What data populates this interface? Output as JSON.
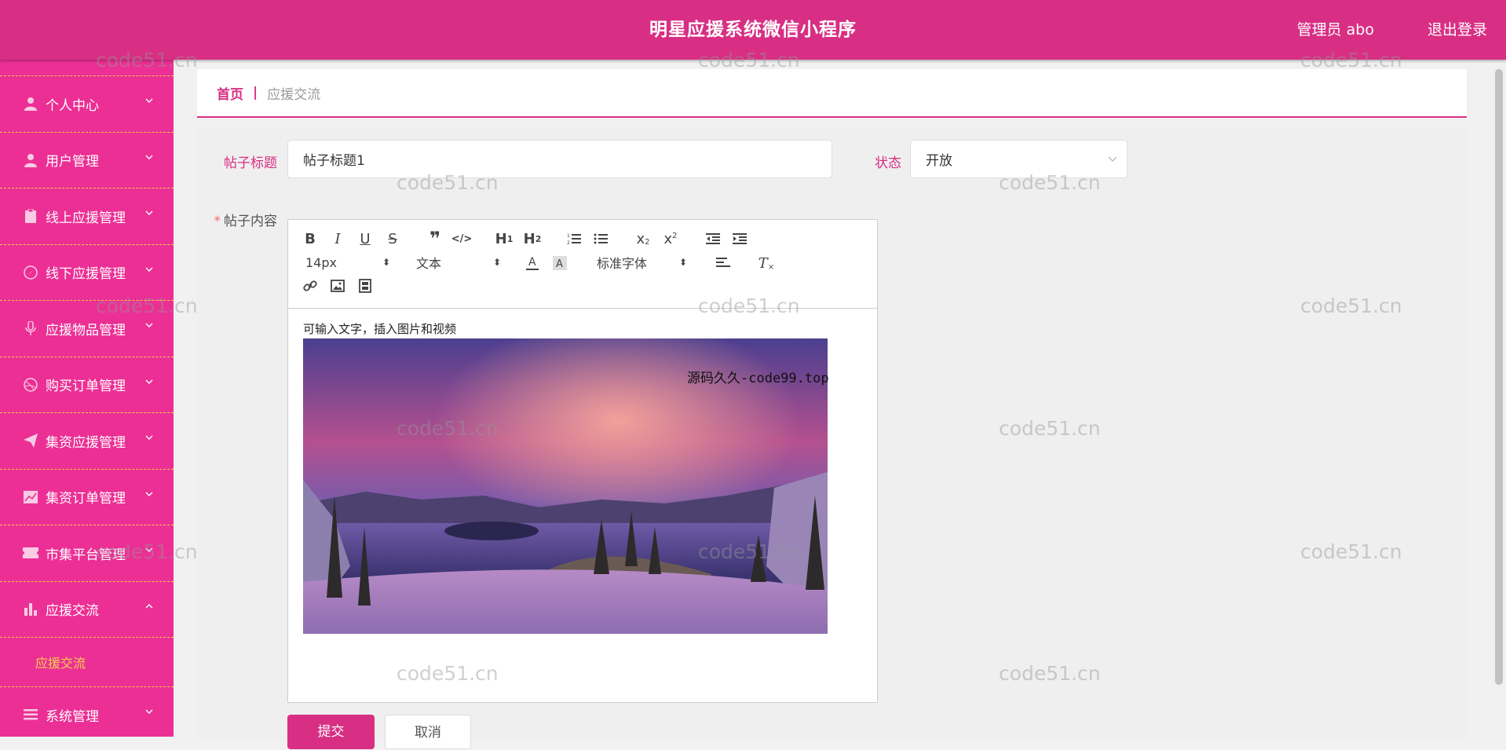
{
  "header": {
    "title": "明星应援系统微信小程序",
    "user": "管理员 abo",
    "logout": "退出登录"
  },
  "sidebar": {
    "items": [
      {
        "label": "个人中心",
        "icon": "user-icon"
      },
      {
        "label": "用户管理",
        "icon": "user-icon"
      },
      {
        "label": "线上应援管理",
        "icon": "clipboard-icon"
      },
      {
        "label": "线下应援管理",
        "icon": "compass-icon"
      },
      {
        "label": "应援物品管理",
        "icon": "microphone-icon"
      },
      {
        "label": "购买订单管理",
        "icon": "dribbble-icon"
      },
      {
        "label": "集资应援管理",
        "icon": "paper-plane-icon"
      },
      {
        "label": "集资订单管理",
        "icon": "chart-icon"
      },
      {
        "label": "市集平台管理",
        "icon": "ticket-icon"
      },
      {
        "label": "应援交流",
        "icon": "bar-chart-icon"
      },
      {
        "label": "系统管理",
        "icon": "list-icon"
      }
    ],
    "sub_item": "应援交流"
  },
  "breadcrumb": {
    "home": "首页",
    "separator": "|",
    "current": "应援交流"
  },
  "form": {
    "title_label": "帖子标题",
    "title_value": "帖子标题1",
    "status_label": "状态",
    "status_value": "开放",
    "content_label": "帖子内容",
    "content_required": "*",
    "content_text": "可输入文字，插入图片和视频",
    "submit": "提交",
    "cancel": "取消"
  },
  "editor_toolbar": {
    "font_size": "14px",
    "format": "文本",
    "font_family": "标准字体"
  },
  "watermark": "code51.cn",
  "overlay_text": "源码久久-code99.top",
  "colors": {
    "accent": "#d82f84",
    "sidebar": "#ec2f95",
    "sidebar_divider": "#f6d04d"
  }
}
